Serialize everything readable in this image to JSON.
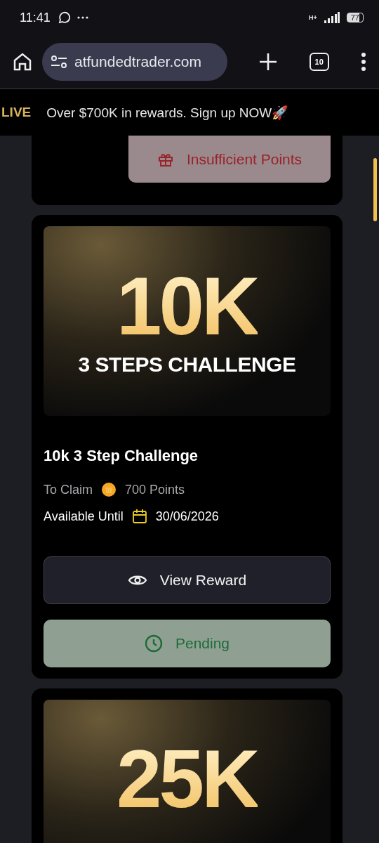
{
  "status_bar": {
    "time": "11:41",
    "network": "H+",
    "battery": "77"
  },
  "browser": {
    "url": "atfundedtrader.com",
    "tab_count": "10"
  },
  "banner": {
    "left": "LIVE",
    "text": "Over $700K in rewards. Sign up NOW🚀"
  },
  "rewards": [
    {
      "actions": [
        {
          "kind": "insufficient",
          "label": "Insufficient Points"
        }
      ]
    },
    {
      "amount": "10K",
      "subtitle": "3 STEPS CHALLENGE",
      "title": "10k 3 Step Challenge",
      "claim_label": "To Claim",
      "points": "700 Points",
      "available_label": "Available Until",
      "date": "30/06/2026",
      "actions": [
        {
          "kind": "view",
          "label": "View Reward"
        },
        {
          "kind": "pending",
          "label": "Pending"
        }
      ]
    },
    {
      "amount": "25K"
    }
  ]
}
